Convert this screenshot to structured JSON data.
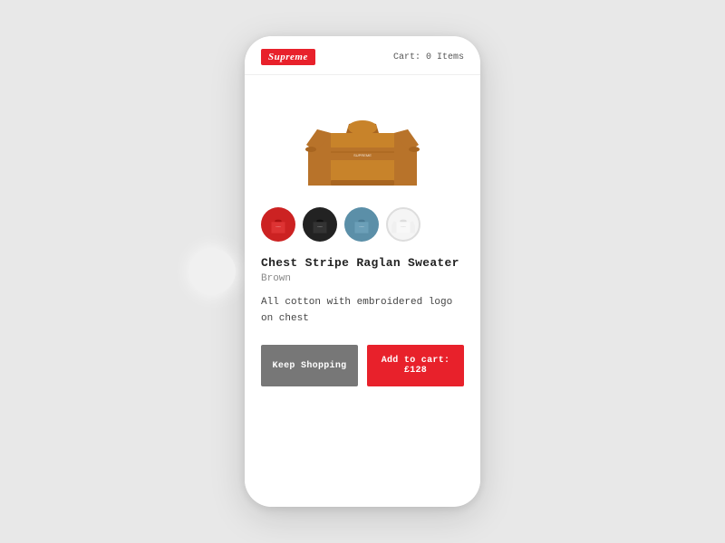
{
  "header": {
    "logo_text": "Supreme",
    "cart_label": "Cart: 0 Items"
  },
  "product": {
    "title": "Chest Stripe Raglan Sweater",
    "color": "Brown",
    "description": "All cotton with embroidered\nlogo on chest",
    "price": "£128",
    "swatches": [
      {
        "name": "red",
        "class": "swatch-red",
        "active": false
      },
      {
        "name": "black",
        "class": "swatch-black",
        "active": false
      },
      {
        "name": "blue",
        "class": "swatch-blue",
        "active": false
      },
      {
        "name": "white",
        "class": "swatch-white",
        "active": false
      }
    ]
  },
  "buttons": {
    "keep_shopping": "Keep Shopping",
    "add_to_cart": "Add to cart: £128"
  },
  "colors": {
    "accent": "#e8212b",
    "logo_bg": "#e8212b",
    "btn_secondary": "#777777"
  }
}
